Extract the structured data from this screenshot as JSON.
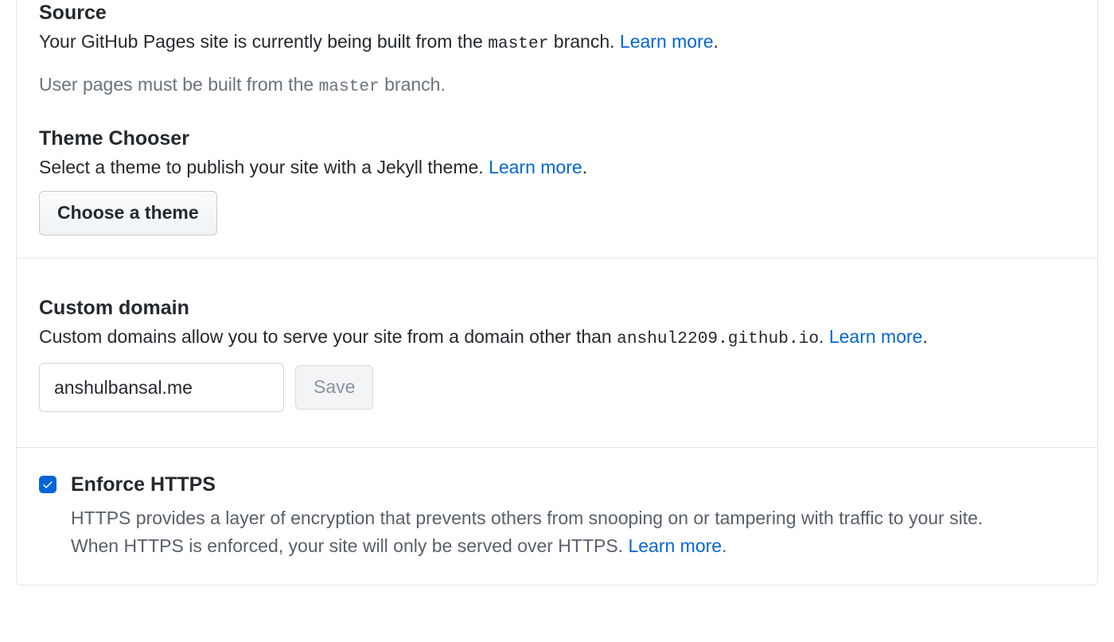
{
  "source": {
    "heading": "Source",
    "desc_pre": "Your GitHub Pages site is currently being built from the ",
    "desc_branch": "master",
    "desc_post": " branch. ",
    "learn_more": "Learn more",
    "hint_pre": "User pages must be built from the ",
    "hint_branch": "master",
    "hint_post": " branch."
  },
  "theme": {
    "heading": "Theme Chooser",
    "desc_pre": "Select a theme to publish your site with a Jekyll theme. ",
    "learn_more": "Learn more",
    "button": "Choose a theme"
  },
  "domain": {
    "heading": "Custom domain",
    "desc_pre": "Custom domains allow you to serve your site from a domain other than ",
    "default_domain": "anshul2209.github.io",
    "desc_post": ". ",
    "learn_more": "Learn more",
    "input_value": "anshulbansal.me",
    "save_label": "Save"
  },
  "https": {
    "heading": "Enforce HTTPS",
    "checked": true,
    "line1": "HTTPS provides a layer of encryption that prevents others from snooping on or tampering with traffic to your site.",
    "line2_pre": "When HTTPS is enforced, your site will only be served over HTTPS. ",
    "learn_more": "Learn more"
  }
}
